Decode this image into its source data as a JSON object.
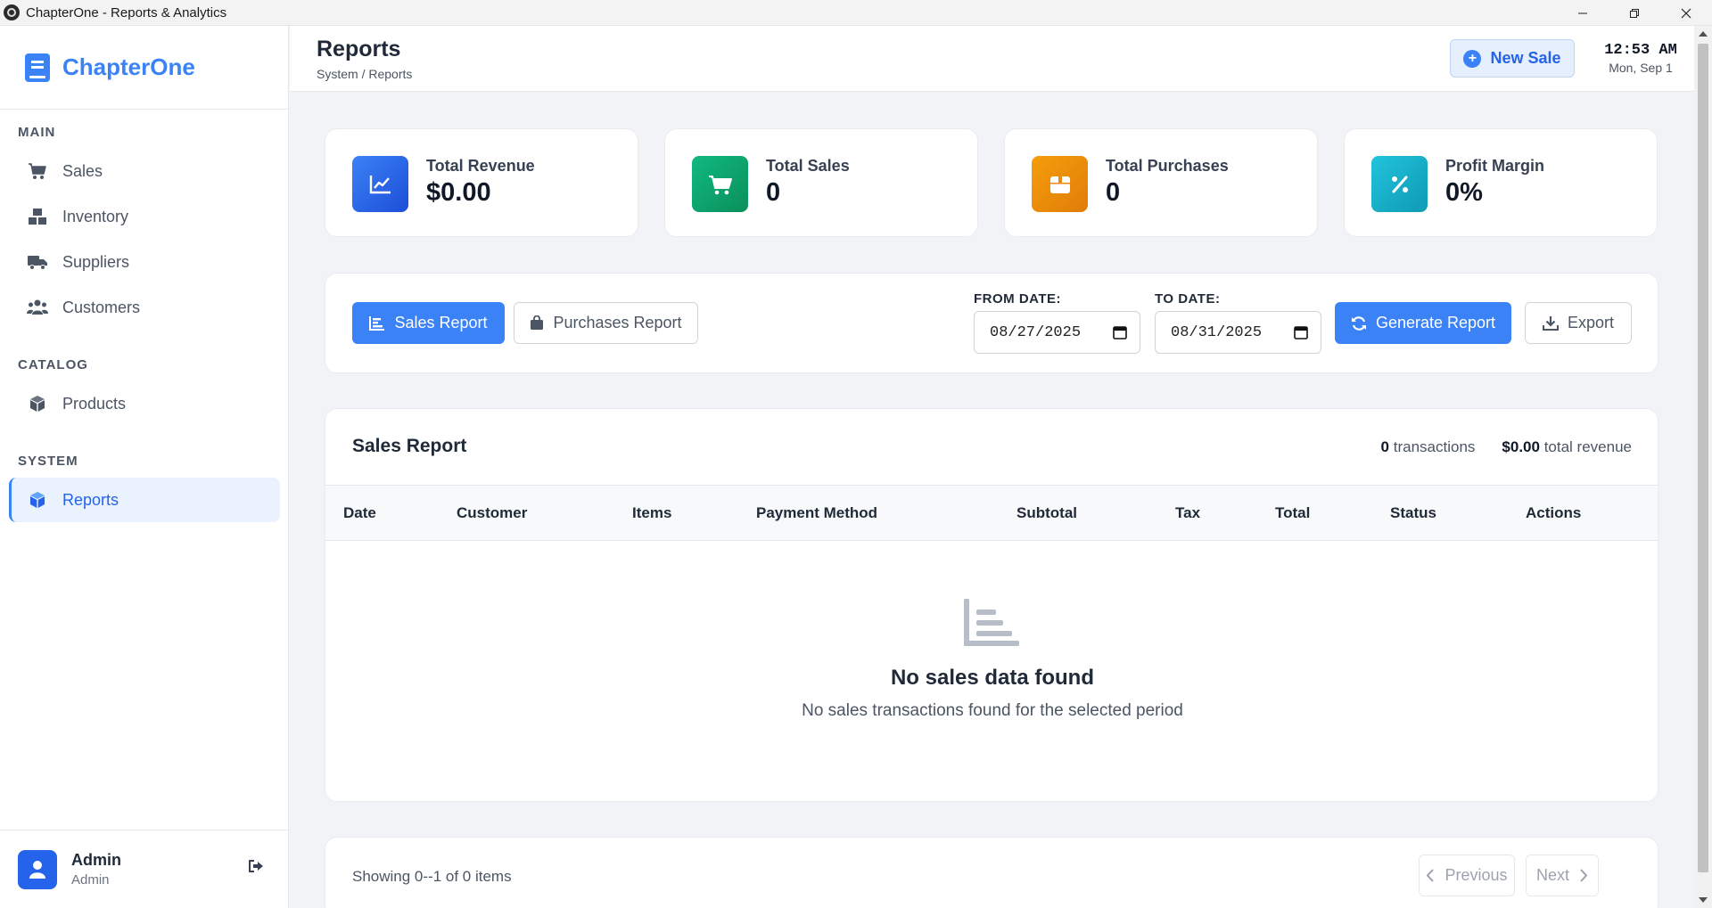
{
  "window": {
    "title": "ChapterOne - Reports & Analytics"
  },
  "sidebar": {
    "brand": "ChapterOne",
    "sections": [
      {
        "label": "MAIN"
      },
      {
        "label": "CATALOG"
      },
      {
        "label": "SYSTEM"
      }
    ],
    "items": [
      {
        "label": "Sales",
        "icon": "cart-icon"
      },
      {
        "label": "Inventory",
        "icon": "boxes-icon"
      },
      {
        "label": "Suppliers",
        "icon": "truck-icon"
      },
      {
        "label": "Customers",
        "icon": "users-icon"
      },
      {
        "label": "Products",
        "icon": "cube-icon"
      },
      {
        "label": "Reports",
        "icon": "cube-icon",
        "active": true
      }
    ],
    "user": {
      "name": "Admin",
      "role": "Admin"
    }
  },
  "header": {
    "title": "Reports",
    "breadcrumb": "System / Reports",
    "new_sale_label": "New Sale",
    "time": "12:53 AM",
    "date": "Mon, Sep 1"
  },
  "stats": [
    {
      "label": "Total Revenue",
      "value": "$0.00",
      "color": "#2f6bf0",
      "icon": "chart-line-icon"
    },
    {
      "label": "Total Sales",
      "value": "0",
      "color": "#10a36b",
      "icon": "cart-icon"
    },
    {
      "label": "Total Purchases",
      "value": "0",
      "color": "#f08a0c",
      "icon": "box-icon"
    },
    {
      "label": "Profit Margin",
      "value": "0%",
      "color": "#14b4cf",
      "icon": "percent-icon"
    }
  ],
  "toolbar": {
    "sales_report_label": "Sales Report",
    "purchases_report_label": "Purchases Report",
    "from_label": "FROM DATE:",
    "from_value": "08/27/2025",
    "to_label": "TO DATE:",
    "to_value": "08/31/2025",
    "generate_label": "Generate Report",
    "export_label": "Export"
  },
  "report": {
    "title": "Sales Report",
    "transactions_count": "0",
    "transactions_label": "transactions",
    "revenue_value": "$0.00",
    "revenue_label": "total revenue",
    "columns": [
      "Date",
      "Customer",
      "Items",
      "Payment Method",
      "Subtotal",
      "Tax",
      "Total",
      "Status",
      "Actions"
    ],
    "rows": [],
    "empty_title": "No sales data found",
    "empty_subtitle": "No sales transactions found for the selected period"
  },
  "pagination": {
    "showing": "Showing 0--1 of 0 items",
    "previous_label": "Previous",
    "next_label": "Next"
  },
  "colors": {
    "accent": "#3b82f6",
    "accent_dark": "#2563eb"
  }
}
